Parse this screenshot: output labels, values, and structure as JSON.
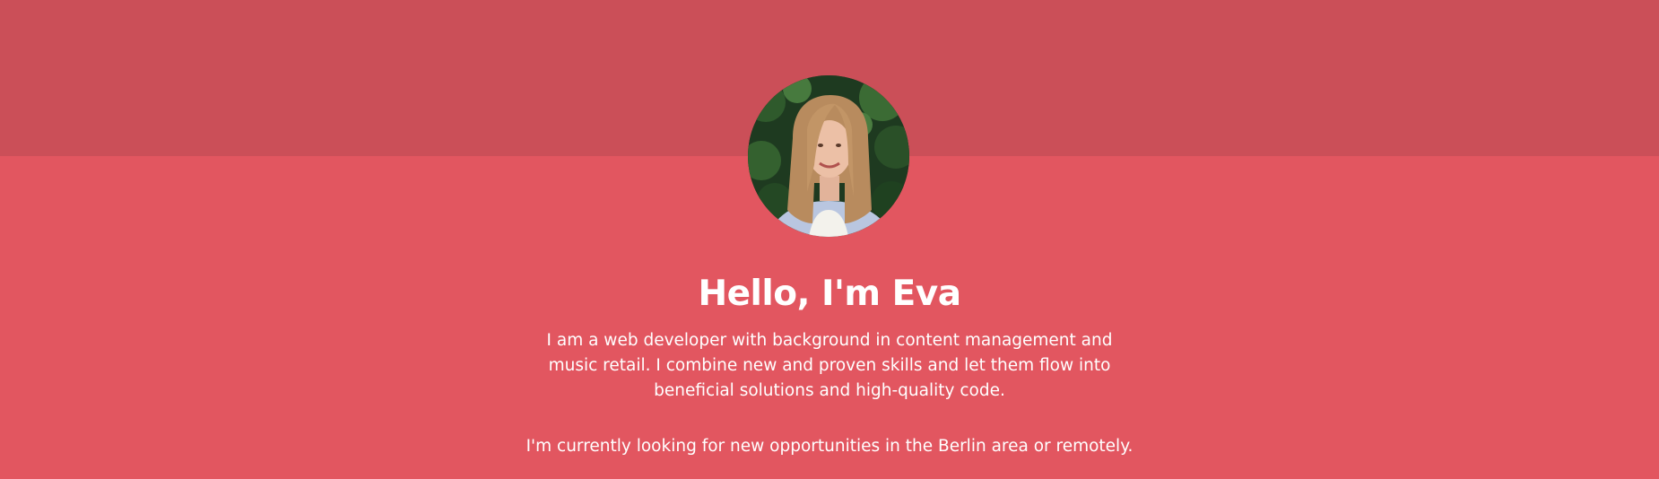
{
  "hero": {
    "avatar_alt": "Portrait of Eva",
    "title": "Hello, I'm Eva",
    "intro": "I am a web developer with background in content management and music retail. I combine new and proven skills and let them flow into beneficial solutions and high-quality code.",
    "status": "I'm currently looking for new opportunities in the Berlin area or remotely."
  },
  "colors": {
    "top_band": "#cb4f58",
    "background": "#e25660",
    "text": "#ffffff"
  }
}
